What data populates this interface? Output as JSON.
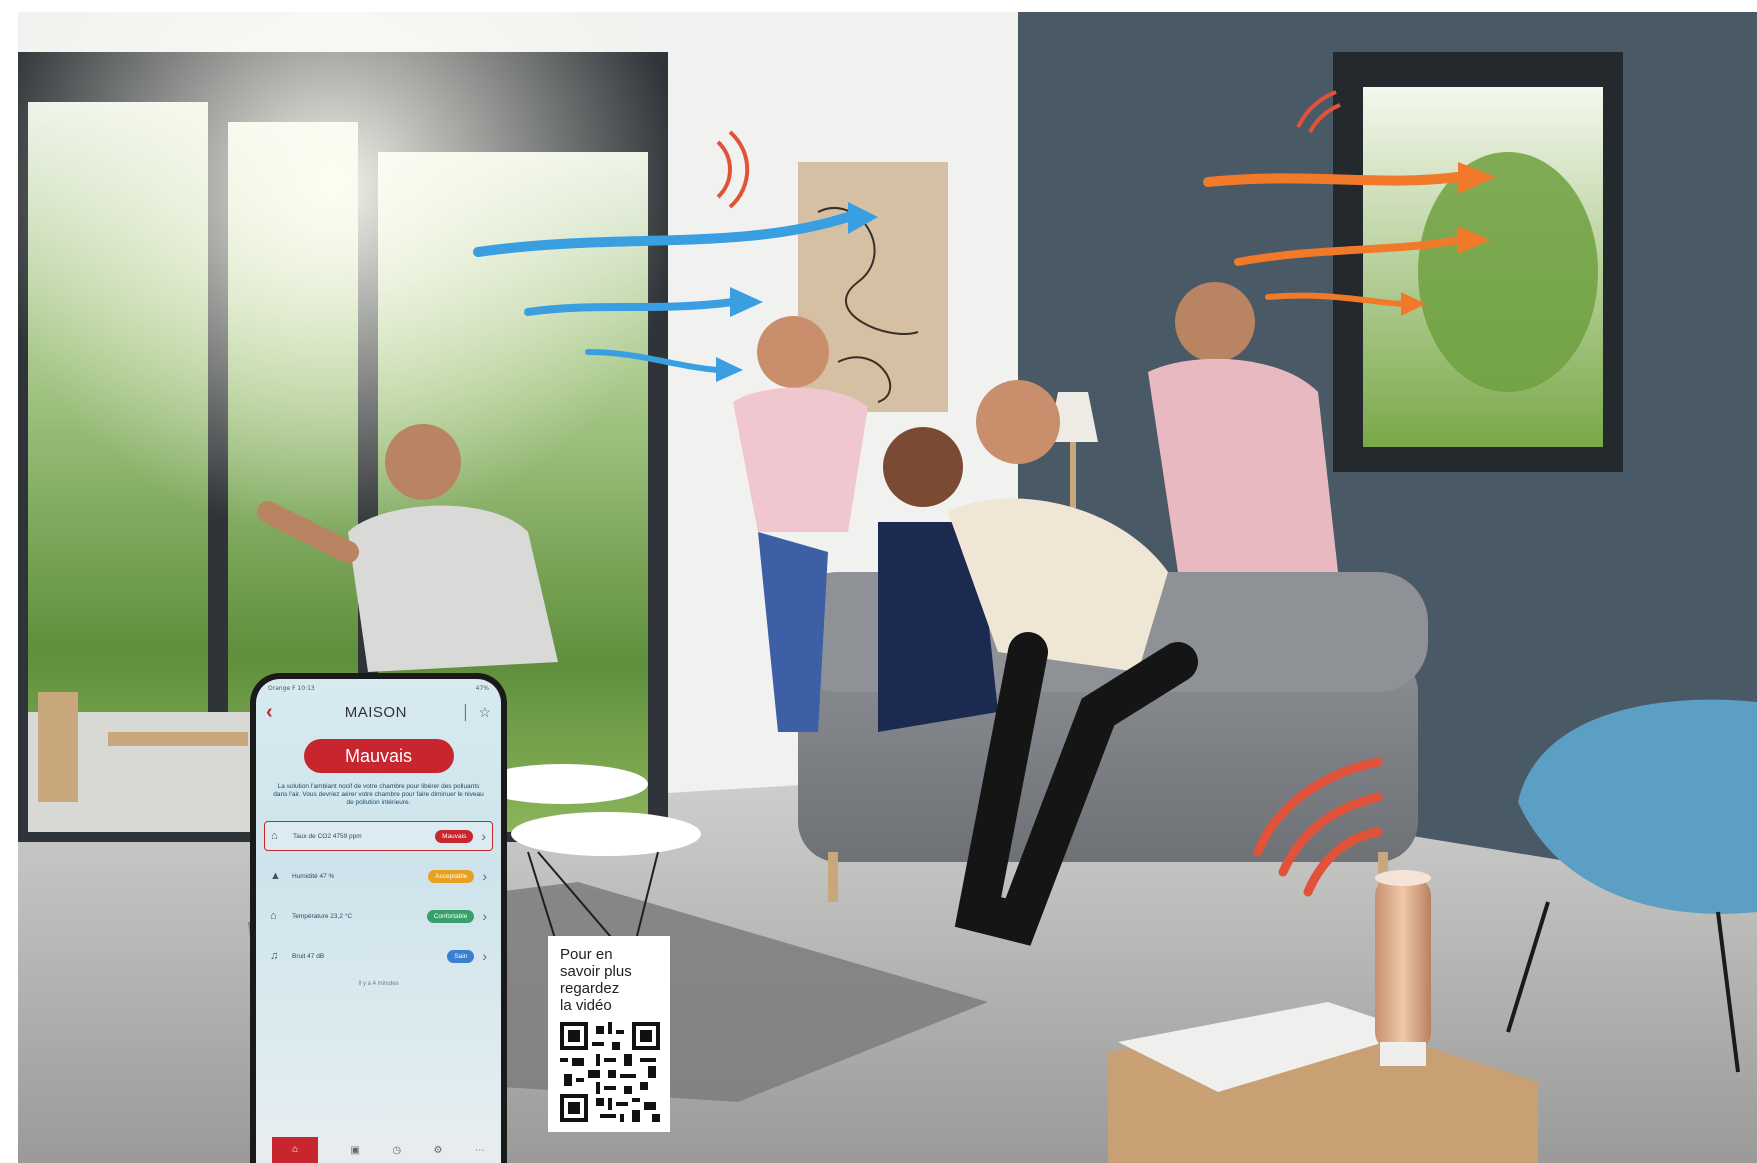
{
  "phone_app": {
    "status_left": "Orange F 10:13",
    "status_right": "47%",
    "title": "MAISON",
    "air_quality_status": "Mauvais",
    "advice": "La solution l'ambiant nocif de votre chambre pour libérer des polluants dans l'air. Vous devriez aérer votre chambre pour faire diminuer le niveau de pollution intérieure.",
    "metrics": [
      {
        "label": "Taux de CO2 4759 ppm",
        "status": "Mauvais",
        "color": "#c8262e",
        "icon": "house-icon"
      },
      {
        "label": "Humidité 47 %",
        "status": "Acceptable",
        "color": "#e8a020",
        "icon": "droplet-icon"
      },
      {
        "label": "Température 23,2 °C",
        "status": "Confortable",
        "color": "#3aa06a",
        "icon": "thermometer-icon"
      },
      {
        "label": "Bruit 47 dB",
        "status": "Sain",
        "color": "#3b7fd0",
        "icon": "sound-icon"
      }
    ],
    "footnote": "Il y a 4 minutes",
    "nav_items": [
      "home-icon",
      "camera-icon",
      "clock-icon",
      "settings-icon",
      "more-icon"
    ]
  },
  "qr_card": {
    "line1": "Pour en",
    "line2": "savoir plus",
    "line3": "regardez",
    "line4": "la vidéo"
  },
  "colors": {
    "accent_red": "#c8262e",
    "wall_blue": "#4a5966",
    "arrow_blue": "#3a9fe0",
    "arrow_orange": "#f07a2a"
  }
}
